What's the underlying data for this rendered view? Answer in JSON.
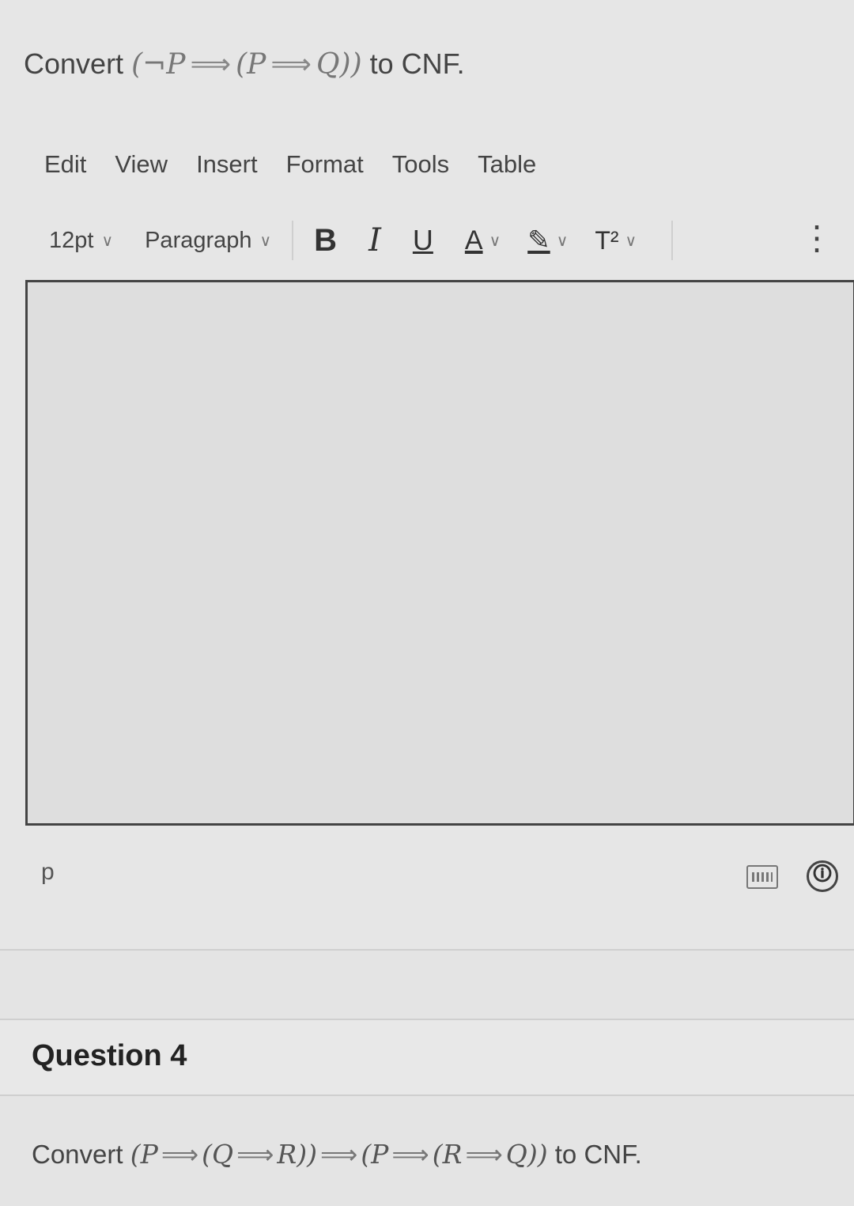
{
  "question3": {
    "prefix": "Convert",
    "formula_parts": [
      "(¬P",
      "⟹",
      "(P",
      "⟹",
      "Q))"
    ],
    "suffix": "to CNF."
  },
  "menubar": {
    "items": [
      "Edit",
      "View",
      "Insert",
      "Format",
      "Tools",
      "Table"
    ]
  },
  "toolbar": {
    "font_size": "12pt",
    "block_format": "Paragraph",
    "bold": "B",
    "italic": "I",
    "underline": "U",
    "text_color": "A",
    "highlight": "✎",
    "superscript": "T²",
    "more": "⋮"
  },
  "editor": {
    "content": "",
    "status_path": "p"
  },
  "icons": {
    "keyboard": "keyboard-icon",
    "accessibility": "accessibility-icon"
  },
  "question4": {
    "title": "Question 4",
    "prefix": "Convert",
    "formula_parts": [
      "(P",
      "⟹",
      "(Q",
      "⟹",
      "R))",
      "⟹",
      "(P",
      "⟹",
      "(R",
      "⟹",
      "Q))"
    ],
    "suffix": "to CNF."
  }
}
